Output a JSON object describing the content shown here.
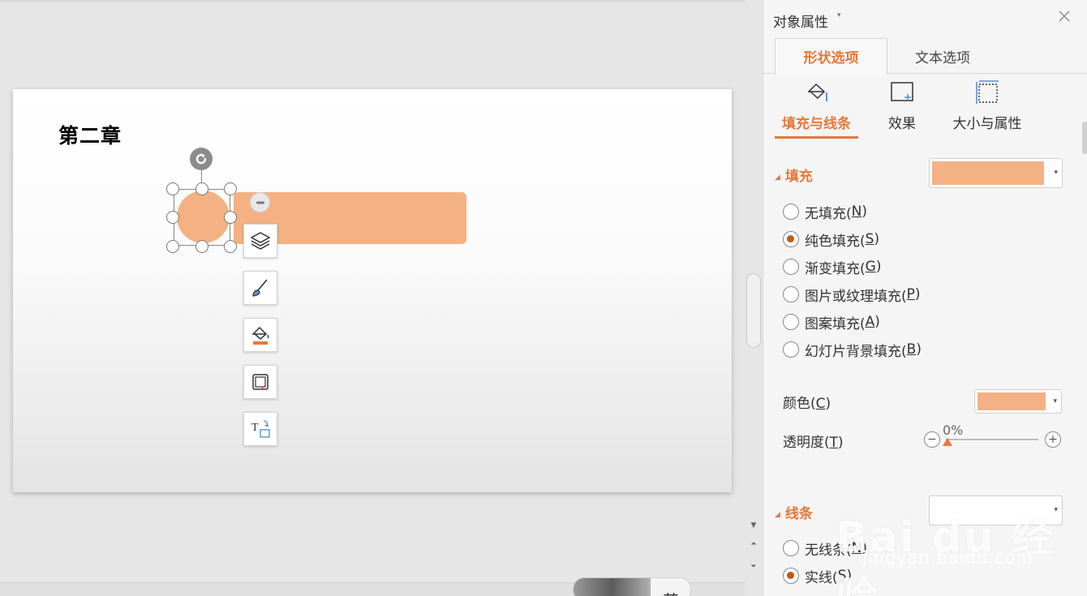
{
  "slide": {
    "title": "第二章"
  },
  "pane": {
    "title": "对象属性",
    "tabs": [
      {
        "label": "形状选项",
        "active": true
      },
      {
        "label": "文本选项",
        "active": false
      }
    ],
    "sub_tabs": [
      {
        "label": "填充与线条",
        "icon": "fill-bucket-icon",
        "active": true
      },
      {
        "label": "效果",
        "icon": "effects-icon",
        "active": false
      },
      {
        "label": "大小与属性",
        "icon": "size-properties-icon",
        "active": false
      }
    ],
    "fill_section": {
      "heading": "填充",
      "swatch_color": "#f4b183",
      "options": [
        {
          "label": "无填充(",
          "key": "N",
          "checked": false
        },
        {
          "label": "纯色填充(",
          "key": "S",
          "checked": true
        },
        {
          "label": "渐变填充(",
          "key": "G",
          "checked": false
        },
        {
          "label": "图片或纹理填充(",
          "key": "P",
          "checked": false
        },
        {
          "label": "图案填充(",
          "key": "A",
          "checked": false
        },
        {
          "label": "幻灯片背景填充(",
          "key": "B",
          "checked": false
        }
      ],
      "color_label": "颜色(",
      "color_key": "C",
      "color_value": "#f4b183",
      "transparency_label": "透明度(",
      "transparency_key": "T",
      "transparency_value": "0%"
    },
    "line_section": {
      "heading": "线条",
      "options": [
        {
          "label": "无线条(",
          "key": "N",
          "checked": false
        },
        {
          "label": "实线(",
          "key": "S",
          "checked": true
        }
      ]
    }
  },
  "ime": {
    "char": "英"
  },
  "watermark": {
    "logo": "Bai du 经验",
    "url": "jingyan.baidu.com"
  },
  "colors": {
    "accent": "#e4793a",
    "shape_fill": "#f4b183"
  }
}
